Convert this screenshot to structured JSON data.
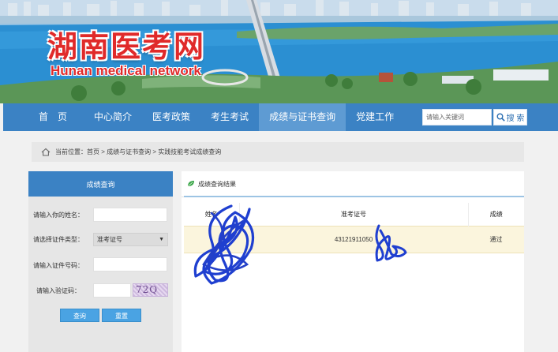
{
  "site": {
    "title": "湖南医考网",
    "subtitle": "Hunan medical network"
  },
  "nav": {
    "items": [
      {
        "label": "首　页"
      },
      {
        "label": "中心简介"
      },
      {
        "label": "医考政策"
      },
      {
        "label": "考生考试"
      },
      {
        "label": "成绩与证书查询"
      },
      {
        "label": "党建工作"
      }
    ],
    "active_index": 4,
    "search_placeholder": "请输入关键词",
    "search_button": "搜 索"
  },
  "breadcrumb": {
    "text": "当前位置：首页 > 成绩与证书查询 > 实践技能考试成绩查询"
  },
  "query_form": {
    "header": "成绩查询",
    "name_label": "请输入你的姓名：",
    "id_type_label": "请选择证件类型：",
    "id_type_value": "准考证号",
    "id_number_label": "请输入证件号码：",
    "captcha_label": "请输入验证码：",
    "captcha_text": "72Q",
    "query_button": "查询",
    "reset_button": "重置"
  },
  "results": {
    "header": "成绩查询结果",
    "columns": [
      "姓名",
      "准考证号",
      "成绩"
    ],
    "rows": [
      {
        "name": "",
        "ticket_no": "43121911050",
        "result": "通过"
      }
    ]
  },
  "colors": {
    "nav_bg": "#3b82c4",
    "nav_active": "#5e9bd3",
    "title_red": "#e02a2a",
    "result_row_bg": "#fbf5dd",
    "redaction_ink": "#1f3fd0"
  }
}
